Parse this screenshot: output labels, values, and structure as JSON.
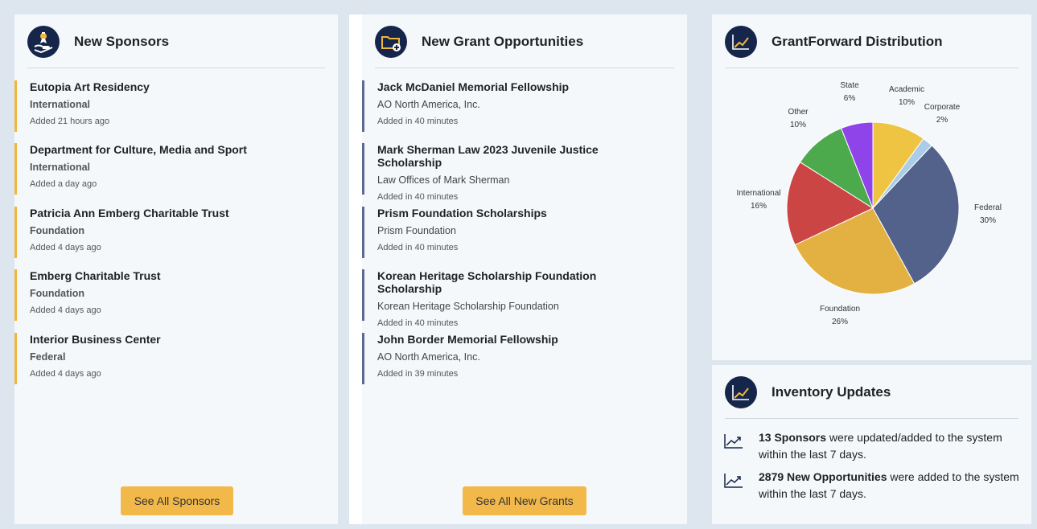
{
  "sponsors": {
    "title": "New Sponsors",
    "button": "See All Sponsors",
    "items": [
      {
        "name": "Eutopia Art Residency",
        "type": "International",
        "added": "Added 21 hours ago"
      },
      {
        "name": "Department for Culture, Media and Sport",
        "type": "International",
        "added": "Added a day ago"
      },
      {
        "name": "Patricia Ann Emberg Charitable Trust",
        "type": "Foundation",
        "added": "Added 4 days ago"
      },
      {
        "name": "Emberg Charitable Trust",
        "type": "Foundation",
        "added": "Added 4 days ago"
      },
      {
        "name": "Interior Business Center",
        "type": "Federal",
        "added": "Added 4 days ago"
      }
    ]
  },
  "grants": {
    "title": "New Grant Opportunities",
    "button": "See All New Grants",
    "items": [
      {
        "name": "Jack McDaniel Memorial Fellowship",
        "org": "AO North America, Inc.",
        "added": "Added in 40 minutes"
      },
      {
        "name": "Mark Sherman Law 2023 Juvenile Justice Scholarship",
        "org": "Law Offices of Mark Sherman",
        "added": "Added in 40 minutes"
      },
      {
        "name": "Prism Foundation Scholarships",
        "org": "Prism Foundation",
        "added": "Added in 40 minutes"
      },
      {
        "name": "Korean Heritage Scholarship Foundation Scholarship",
        "org": "Korean Heritage Scholarship Foundation",
        "added": "Added in 40 minutes"
      },
      {
        "name": "John Border Memorial Fellowship",
        "org": "AO North America, Inc.",
        "added": "Added in 39 minutes"
      }
    ]
  },
  "distribution": {
    "title": "GrantForward Distribution"
  },
  "chart_data": {
    "type": "pie",
    "title": "",
    "slices": [
      {
        "label": "Academic",
        "value": 10,
        "pct": "10%",
        "color": "#efc442"
      },
      {
        "label": "Corporate",
        "value": 2,
        "pct": "2%",
        "color": "#abcdea"
      },
      {
        "label": "Federal",
        "value": 30,
        "pct": "30%",
        "color": "#52628a"
      },
      {
        "label": "Foundation",
        "value": 26,
        "pct": "26%",
        "color": "#e3b042"
      },
      {
        "label": "International",
        "value": 16,
        "pct": "16%",
        "color": "#cc4545"
      },
      {
        "label": "Other",
        "value": 10,
        "pct": "10%",
        "color": "#4caa4c"
      },
      {
        "label": "State",
        "value": 6,
        "pct": "6%",
        "color": "#8f44ea"
      }
    ]
  },
  "inventory": {
    "title": "Inventory Updates",
    "rows": [
      {
        "bold": "13 Sponsors",
        "text": " were updated/added to the system within the last 7 days."
      },
      {
        "bold": "2879 New Opportunities",
        "text": " were added to the system within the last 7 days."
      }
    ]
  },
  "icons": {
    "sponsors": "sponsor-hand-icon",
    "grants": "folder-add-icon",
    "distribution": "line-chart-icon",
    "inventory": "line-chart-icon",
    "trend": "trend-up-icon"
  },
  "colors": {
    "sponsor_accent": "#f0b73c",
    "grant_accent": "#5a6a93",
    "button": "#f3b84a",
    "icon_bg": "#16264a"
  }
}
